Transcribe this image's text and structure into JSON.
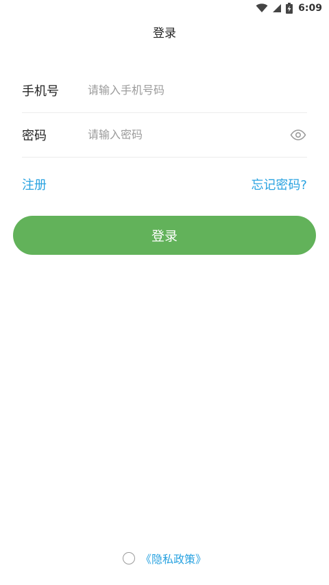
{
  "status_bar": {
    "time": "6:09",
    "icons": [
      "wifi-icon",
      "cell-signal-icon",
      "battery-charging-icon"
    ]
  },
  "header": {
    "title": "登录"
  },
  "form": {
    "phone": {
      "label": "手机号",
      "placeholder": "请输入手机号码",
      "value": ""
    },
    "password": {
      "label": "密码",
      "placeholder": "请输入密码",
      "value": "",
      "toggle_icon": "eye-icon"
    }
  },
  "links": {
    "register": "注册",
    "forgot_password": "忘记密码?"
  },
  "login_button": {
    "label": "登录"
  },
  "privacy": {
    "checked": false,
    "link_text": "《隐私政策》"
  },
  "colors": {
    "accent_green": "#62b25a",
    "link_blue": "#28a2e0",
    "placeholder_gray": "#9b9b9b",
    "divider": "#ececec"
  }
}
